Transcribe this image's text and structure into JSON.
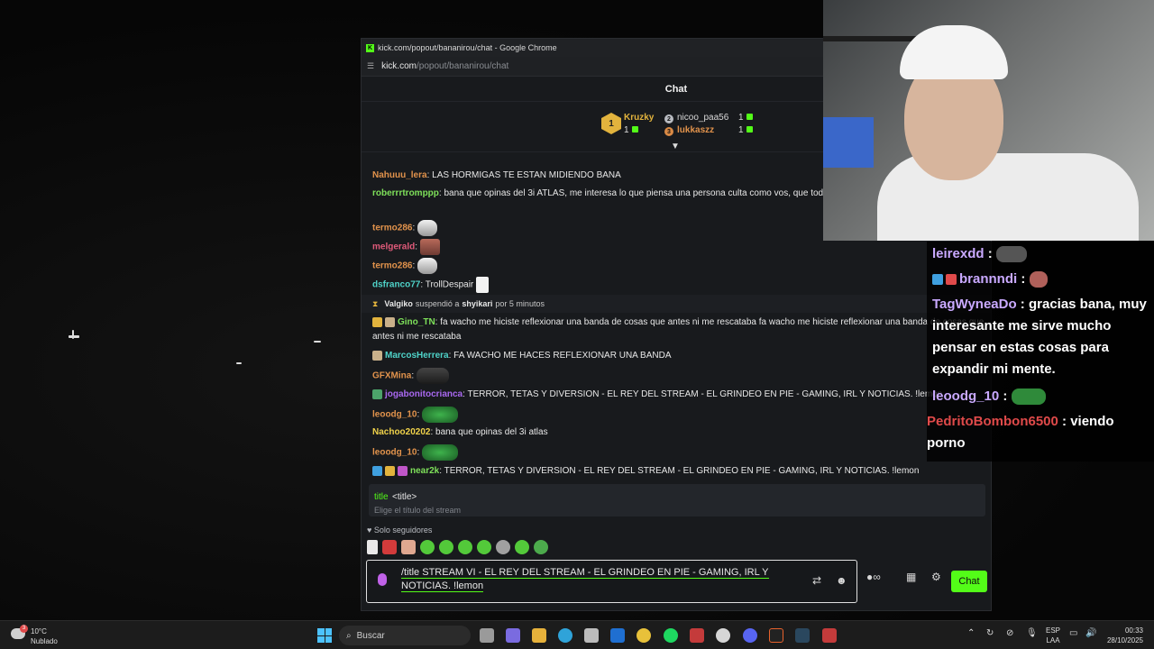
{
  "browser": {
    "window_title": "kick.com/popout/bananirou/chat - Google Chrome",
    "url_host": "kick.com",
    "url_path": "/popout/bananirou/chat"
  },
  "chat": {
    "header": "Chat",
    "leaderboard": {
      "first": {
        "rank": "1",
        "name": "Kruzky",
        "count": "1"
      },
      "second": {
        "rank": "2",
        "name": "nicoo_paa56",
        "count": "1"
      },
      "third": {
        "rank": "3",
        "name": "lukkaszz",
        "count": "1"
      }
    },
    "messages": [
      {
        "user": "Nahuuu_lera",
        "color": "#e2934c",
        "text": ": LAS HORMIGAS TE ESTAN MIDIENDO BANA"
      },
      {
        "user": "roberrrtromppp",
        "color": "#7ee05a",
        "text": ": bana que opinas del 3i ATLAS, me interesa lo que piensa una persona culta como vos, que tod simulacion, y que viene desde abajo."
      },
      {
        "user": "termo286",
        "color": "#e2934c",
        "text": ":"
      },
      {
        "user": "melgerald",
        "color": "#e05a7a",
        "text": ":"
      },
      {
        "user": "termo286",
        "color": "#e2934c",
        "text": ":"
      },
      {
        "user": "dsfranco77",
        "color": "#4fd3c9",
        "text": ": TrollDespair"
      },
      {
        "user": "Gino_TN",
        "color": "#7ee05a",
        "text": ": fa wacho me hiciste reflexionar una banda de cosas que antes ni me rescataba fa wacho me hiciste reflexionar una banda de cosas que antes ni me rescataba"
      },
      {
        "user": "MarcosHerrera",
        "color": "#4fd3c9",
        "text": ": FA WACHO ME HACES REFLEXIONAR UNA BANDA"
      },
      {
        "user": "GFXMina",
        "color": "#e2934c",
        "text": ":"
      },
      {
        "user": "jogabonitocrianca",
        "color": "#a968f0",
        "text": ": TERROR, TETAS Y DIVERSION - EL REY DEL STREAM - EL GRINDEO EN PIE - GAMING, IRL Y NOTICIAS. !lemon"
      },
      {
        "user": "leoodg_10",
        "color": "#e2934c",
        "text": ":"
      },
      {
        "user": "Nachoo20202",
        "color": "#f0d24a",
        "text": ": bana que opinas del 3i atlas"
      },
      {
        "user": "leoodg_10",
        "color": "#e2934c",
        "text": ":"
      },
      {
        "user": "near2k",
        "color": "#7ee05a",
        "text": ": TERROR, TETAS Y DIVERSION - EL REY DEL STREAM - EL GRINDEO EN PIE - GAMING, IRL Y NOTICIAS. !lemon"
      }
    ],
    "system": {
      "actor": "Valgiko",
      "verb": "suspendió a",
      "target": "shyikari",
      "suffix": "por 5 minutos"
    },
    "command_hint": {
      "cmd": "title",
      "arg": "<title>",
      "desc": "Elige el título del stream"
    },
    "followers_only": "Solo seguidores",
    "input_value": "/title STREAM VI - EL REY DEL STREAM - EL GRINDEO EN PIE - GAMING, IRL Y NOTICIAS. !lemon",
    "send_label": "Chat"
  },
  "overlay": [
    {
      "user": "leirexdd",
      "color": "#c9a9ff",
      "text": " :"
    },
    {
      "user": "brannndi",
      "color": "#c9a9ff",
      "text": " :"
    },
    {
      "user": "TagWyneaDo",
      "color": "#c9a9ff",
      "text": " : gracias bana, muy interesante me sirve mucho pensar en estas cosas para expandir mi mente."
    },
    {
      "user": "leoodg_10",
      "color": "#c9a9ff",
      "text": " :"
    },
    {
      "user": "PedritoBombon6500",
      "color": "#e04a4a",
      "text": " : viendo porno"
    }
  ],
  "taskbar": {
    "weather_temp": "10°C",
    "weather_desc": "Nublado",
    "weather_alert": "3",
    "search_label": "Buscar",
    "lang_1": "ESP",
    "lang_2": "LAA",
    "time": "00:33",
    "date": "28/10/2025"
  }
}
